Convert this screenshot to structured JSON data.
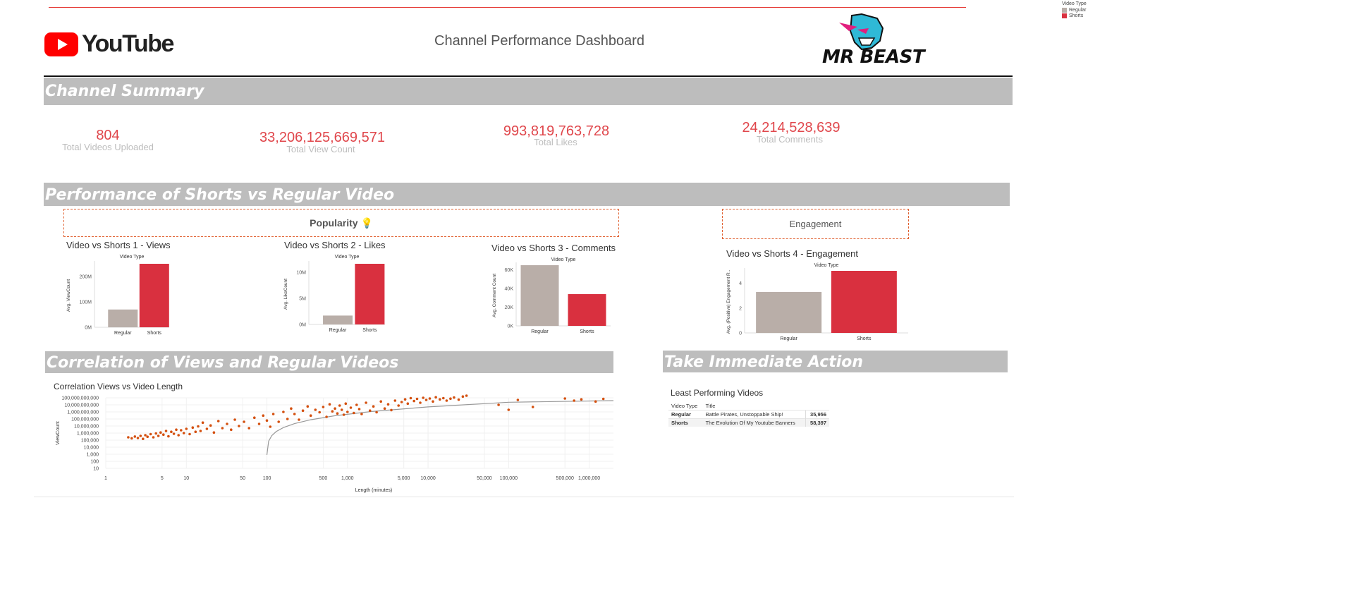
{
  "header": {
    "brand_text": "YouTube",
    "title": "Channel Performance Dashboard",
    "logo_text": "MR BEAST"
  },
  "legend": {
    "title": "Video Type",
    "items": [
      {
        "label": "Regular",
        "color": "#b9aea8"
      },
      {
        "label": "Shorts",
        "color": "#d9303f"
      }
    ]
  },
  "summary": {
    "banner": "Channel Summary",
    "kpis": [
      {
        "value": "804",
        "label": "Total Videos Uploaded"
      },
      {
        "value": "33,206,125,669,571",
        "label": "Total View Count"
      },
      {
        "value": "993,819,763,728",
        "label": "Total Likes"
      },
      {
        "value": "24,214,528,639",
        "label": "Total Comments"
      }
    ]
  },
  "performance": {
    "banner": "Performance of Shorts vs Regular Video",
    "popularity_label": "Popularity 💡",
    "engagement_label": "Engagement"
  },
  "correlation": {
    "banner": "Correlation of Views and Regular Videos",
    "chart_title": "Correlation Views vs Video Length"
  },
  "action": {
    "banner": "Take Immediate Action",
    "table_title": "Least Performing Videos",
    "columns": [
      "Video Type",
      "Title",
      ""
    ],
    "rows": [
      {
        "type": "Regular",
        "title": "Battle Pirates, Unstoppable Ship!",
        "value": "35,956"
      },
      {
        "type": "Shorts",
        "title": "The Evolution Of My Youtube Banners",
        "value": "58,397"
      }
    ]
  },
  "chart_data": [
    {
      "type": "bar",
      "title": "Video vs Shorts 1 - Views",
      "legend_title": "Video Type",
      "categories": [
        "Regular",
        "Shorts"
      ],
      "values": [
        70000000,
        250000000
      ],
      "ylabel": "Avg. ViewCount",
      "yticks": [
        0,
        100000000,
        200000000
      ],
      "ytick_labels": [
        "0M",
        "100M",
        "200M"
      ],
      "ylim": [
        0,
        250000000
      ],
      "colors": [
        "#b9aea8",
        "#d9303f"
      ]
    },
    {
      "type": "bar",
      "title": "Video vs Shorts 2 - Likes",
      "legend_title": "Video Type",
      "categories": [
        "Regular",
        "Shorts"
      ],
      "values": [
        1700000,
        11600000
      ],
      "ylabel": "Avg. LikeCount",
      "yticks": [
        0,
        5000000,
        10000000
      ],
      "ytick_labels": [
        "0M",
        "5M",
        "10M"
      ],
      "ylim": [
        0,
        11600000
      ],
      "colors": [
        "#b9aea8",
        "#d9303f"
      ]
    },
    {
      "type": "bar",
      "title": "Video vs Shorts 3 -  Comments",
      "legend_title": "Video Type",
      "categories": [
        "Regular",
        "Shorts"
      ],
      "values": [
        65000,
        34000
      ],
      "ylabel": "Avg. Comment Count",
      "yticks": [
        0,
        20000,
        40000,
        60000
      ],
      "ytick_labels": [
        "0K",
        "20K",
        "40K",
        "60K"
      ],
      "ylim": [
        0,
        65000
      ],
      "colors": [
        "#b9aea8",
        "#d9303f"
      ]
    },
    {
      "type": "bar",
      "title": "Video vs Shorts 4 -  Engagement",
      "legend_title": "Video Type",
      "categories": [
        "Regular",
        "Shorts"
      ],
      "values": [
        3.3,
        5.0
      ],
      "ylabel": "Avg. (Positive) Engagement R..",
      "yticks": [
        0,
        2,
        4
      ],
      "ytick_labels": [
        "0",
        "2",
        "4"
      ],
      "ylim": [
        0,
        5.0
      ],
      "colors": [
        "#b9aea8",
        "#d9303f"
      ]
    },
    {
      "type": "scatter",
      "title": "Correlation Views vs Video Length",
      "xlabel": "Length (minutes)",
      "ylabel": "ViewCount",
      "xscale": "log",
      "yscale": "log",
      "xlim": [
        1,
        2000000
      ],
      "ylim": [
        10,
        100000000000
      ],
      "xticks": [
        1,
        5,
        10,
        50,
        100,
        500,
        1000,
        5000,
        10000,
        50000,
        100000,
        500000,
        1000000
      ],
      "xtick_labels": [
        "1",
        "5",
        "10",
        "50",
        "100",
        "500",
        "1,000",
        "5,000",
        "10,000",
        "50,000",
        "100,000",
        "500,000",
        "1,000,000"
      ],
      "yticks": [
        10,
        100,
        1000,
        10000,
        100000,
        1000000,
        10000000,
        100000000,
        1000000000,
        10000000000,
        100000000000
      ],
      "ytick_labels": [
        "10",
        "100",
        "1,000",
        "10,000",
        "100,000",
        "1,000,000",
        "10,000,000",
        "100,000,000",
        "1,000,000,000",
        "10,000,000,000",
        "100,000,000,000"
      ],
      "color": "#d4500f",
      "trend_line": true,
      "points": [
        [
          1.9,
          250000
        ],
        [
          2.1,
          180000
        ],
        [
          2.3,
          320000
        ],
        [
          2.5,
          200000
        ],
        [
          2.7,
          400000
        ],
        [
          2.9,
          150000
        ],
        [
          3.1,
          500000
        ],
        [
          3.3,
          300000
        ],
        [
          3.6,
          700000
        ],
        [
          3.9,
          250000
        ],
        [
          4.2,
          900000
        ],
        [
          4.5,
          400000
        ],
        [
          4.8,
          1200000
        ],
        [
          5.2,
          600000
        ],
        [
          5.6,
          2000000
        ],
        [
          6.0,
          350000
        ],
        [
          6.5,
          1500000
        ],
        [
          7.0,
          800000
        ],
        [
          7.5,
          3000000
        ],
        [
          8.0,
          500000
        ],
        [
          8.6,
          2500000
        ],
        [
          9.3,
          1000000
        ],
        [
          10,
          4000000
        ],
        [
          11,
          700000
        ],
        [
          12,
          6000000
        ],
        [
          13,
          1500000
        ],
        [
          14,
          9000000
        ],
        [
          15,
          2000000
        ],
        [
          16,
          30000000
        ],
        [
          18,
          4000000
        ],
        [
          20,
          12000000
        ],
        [
          22,
          1200000
        ],
        [
          25,
          50000000
        ],
        [
          28,
          5000000
        ],
        [
          32,
          20000000
        ],
        [
          36,
          3000000
        ],
        [
          40,
          80000000
        ],
        [
          45,
          10000000
        ],
        [
          52,
          40000000
        ],
        [
          60,
          5000000
        ],
        [
          70,
          150000000
        ],
        [
          80,
          20000000
        ],
        [
          90,
          300000000
        ],
        [
          100,
          60000000
        ],
        [
          110,
          8000000
        ],
        [
          120,
          500000000
        ],
        [
          140,
          40000000
        ],
        [
          160,
          1000000000
        ],
        [
          180,
          100000000
        ],
        [
          200,
          3000000000
        ],
        [
          220,
          500000000
        ],
        [
          250,
          80000000
        ],
        [
          280,
          1500000000
        ],
        [
          320,
          6000000000
        ],
        [
          350,
          300000000
        ],
        [
          400,
          2000000000
        ],
        [
          450,
          900000000
        ],
        [
          500,
          5000000000
        ],
        [
          550,
          200000000
        ],
        [
          600,
          12000000000
        ],
        [
          650,
          1200000000
        ],
        [
          700,
          3000000000
        ],
        [
          750,
          600000000
        ],
        [
          800,
          8000000000
        ],
        [
          850,
          2000000000
        ],
        [
          900,
          400000000
        ],
        [
          950,
          15000000000
        ],
        [
          1000,
          1000000000
        ],
        [
          1100,
          4000000000
        ],
        [
          1200,
          700000000
        ],
        [
          1300,
          10000000000
        ],
        [
          1400,
          2500000000
        ],
        [
          1500,
          500000000
        ],
        [
          1700,
          20000000000
        ],
        [
          1900,
          1500000000
        ],
        [
          2100,
          6000000000
        ],
        [
          2300,
          900000000
        ],
        [
          2600,
          30000000000
        ],
        [
          2900,
          3000000000
        ],
        [
          3200,
          12000000000
        ],
        [
          3500,
          1800000000
        ],
        [
          3900,
          40000000000
        ],
        [
          4300,
          8000000000
        ],
        [
          4700,
          25000000000
        ],
        [
          5200,
          60000000000
        ],
        [
          5600,
          15000000000
        ],
        [
          6100,
          90000000000
        ],
        [
          6700,
          35000000000
        ],
        [
          7300,
          70000000000
        ],
        [
          8000,
          20000000000
        ],
        [
          8700,
          100000000000
        ],
        [
          9500,
          50000000000
        ],
        [
          10500,
          80000000000
        ],
        [
          11500,
          30000000000
        ],
        [
          12500,
          120000000000
        ],
        [
          14000,
          60000000000
        ],
        [
          15500,
          90000000000
        ],
        [
          17000,
          40000000000
        ],
        [
          19000,
          75000000000
        ],
        [
          21000,
          110000000000
        ],
        [
          24000,
          55000000000
        ],
        [
          27000,
          150000000000
        ],
        [
          30000,
          200000000000
        ],
        [
          75000,
          10000000000
        ],
        [
          100000,
          2000000000
        ],
        [
          130000,
          50000000000
        ],
        [
          200000,
          5000000000
        ],
        [
          500000,
          80000000000
        ],
        [
          650000,
          40000000000
        ],
        [
          800000,
          60000000000
        ],
        [
          1200000,
          30000000000
        ],
        [
          1500000,
          70000000000
        ]
      ]
    }
  ]
}
